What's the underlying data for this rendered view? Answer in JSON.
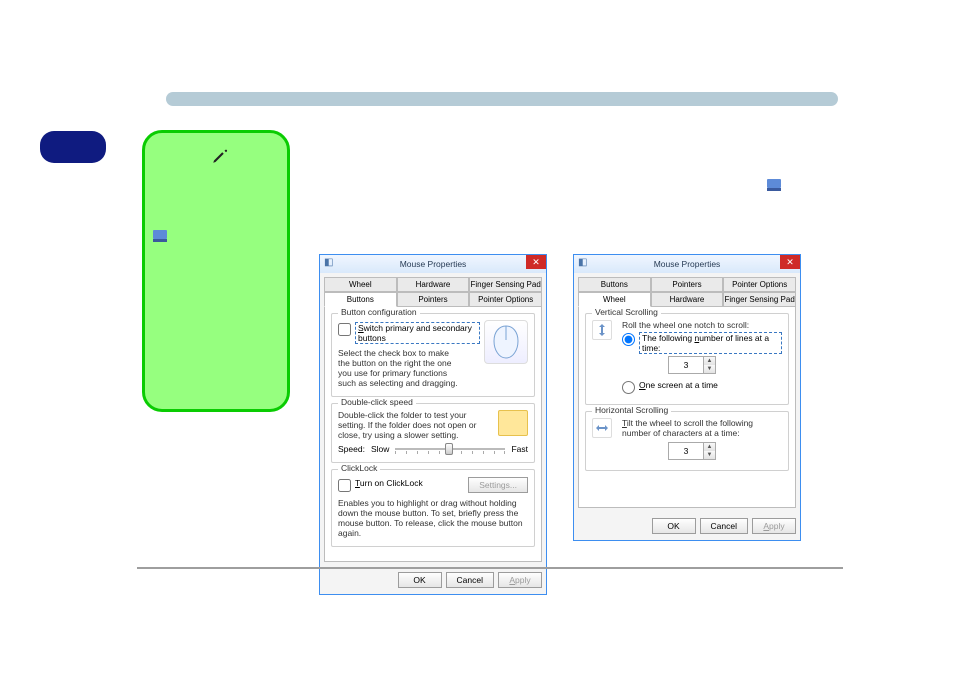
{
  "dialog_title": "Mouse Properties",
  "tabs_row1": [
    "Wheel",
    "Hardware",
    "Finger Sensing Pad"
  ],
  "tabs_row2": [
    "Buttons",
    "Pointers",
    "Pointer Options"
  ],
  "left": {
    "active_tab": "Buttons",
    "group_button_config": {
      "title": "Button configuration",
      "switch_label": "Switch primary and secondary buttons",
      "desc": "Select the check box to make the button on the right the one you use for primary functions such as selecting and dragging."
    },
    "group_dclick": {
      "title": "Double-click speed",
      "desc": "Double-click the folder to test your setting. If the folder does not open or close, try using a slower setting.",
      "speed_label": "Speed:",
      "slow": "Slow",
      "fast": "Fast"
    },
    "group_clicklock": {
      "title": "ClickLock",
      "turn_on": "Turn on ClickLock",
      "settings_btn": "Settings...",
      "desc": "Enables you to highlight or drag without holding down the mouse button. To set, briefly press the mouse button. To release, click the mouse button again."
    }
  },
  "right": {
    "active_tab": "Wheel",
    "group_vscroll": {
      "title": "Vertical Scrolling",
      "intro": "Roll the wheel one notch to scroll:",
      "opt_lines": "The following number of lines at a time:",
      "lines_value": "3",
      "opt_screen": "One screen at a time"
    },
    "group_hscroll": {
      "title": "Horizontal Scrolling",
      "intro": "Tilt the wheel to scroll the following number of characters at a time:",
      "chars_value": "3"
    }
  },
  "buttons": {
    "ok": "OK",
    "cancel": "Cancel",
    "apply": "Apply"
  }
}
